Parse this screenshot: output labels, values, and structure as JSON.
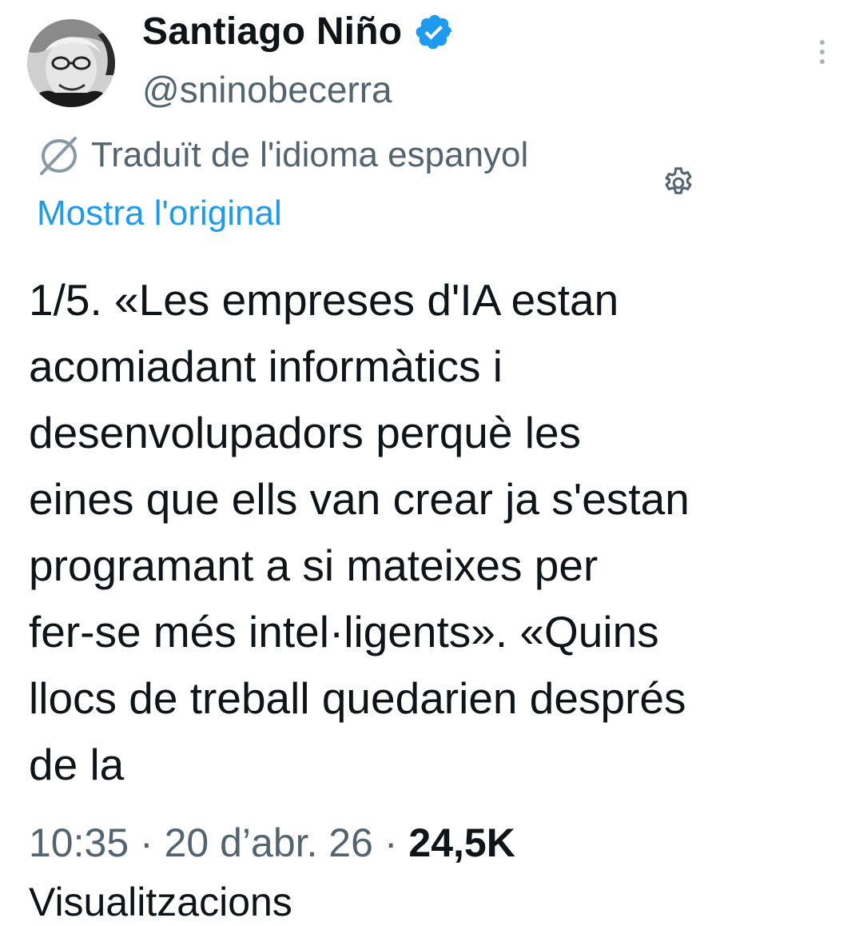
{
  "author": {
    "name": "Santiago Niño",
    "handle": "@sninobecerra",
    "verified_icon": "verified-badge-icon",
    "verified_color": "#1d9bf0"
  },
  "translation": {
    "notice": "Traduït de l'idioma espanyol",
    "show_original": "Mostra l'original",
    "icon": "translate-icon",
    "settings_icon": "gear-icon"
  },
  "tweet": {
    "text": "1/5. «Les empreses d'IA estan\nacomiadant informàtics i\ndesenvolupadors perquè les\neines que ells van crear ja s'estan\nprogramant a si mateixes per\nfer-se més intel·ligents». «Quins\nllocs de treball quedarien després\nde la",
    "time": "10:35",
    "separator": "·",
    "date": "20 d’abr. 26",
    "views_count": "24,5K",
    "views_label_partial": "Visualitzacions"
  },
  "colors": {
    "text_primary": "#0f1419",
    "text_secondary": "#536471",
    "link": "#1d9bf0"
  }
}
